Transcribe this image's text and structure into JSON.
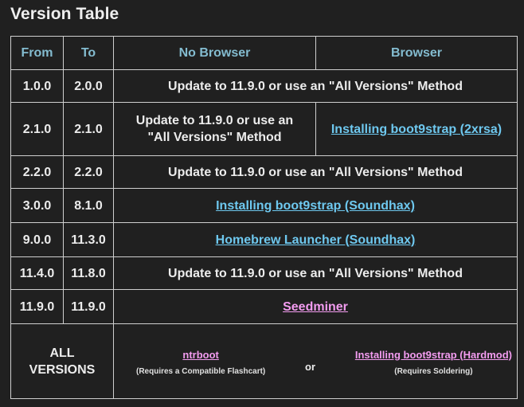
{
  "title": "Version Table",
  "headers": {
    "from": "From",
    "to": "To",
    "no_browser": "No Browser",
    "browser": "Browser"
  },
  "rows": [
    {
      "from": "1.0.0",
      "to": "2.0.0",
      "text": "Update to 11.9.0 or use an \"All Versions\" Method"
    },
    {
      "from": "2.1.0",
      "to": "2.1.0",
      "no_browser": "Update to 11.9.0 or use an \"All Versions\" Method",
      "browser_link": "Installing boot9strap (2xrsa)"
    },
    {
      "from": "2.2.0",
      "to": "2.2.0",
      "text": "Update to 11.9.0 or use an \"All Versions\" Method"
    },
    {
      "from": "3.0.0",
      "to": "8.1.0",
      "link": "Installing boot9strap (Soundhax)"
    },
    {
      "from": "9.0.0",
      "to": "11.3.0",
      "link": "Homebrew Launcher (Soundhax)"
    },
    {
      "from": "11.4.0",
      "to": "11.8.0",
      "text": "Update to 11.9.0 or use an \"All Versions\" Method"
    },
    {
      "from": "11.9.0",
      "to": "11.9.0",
      "link": "Seedminer"
    }
  ],
  "all_versions": {
    "label": "ALL VERSIONS",
    "ntrboot_link": "ntrboot",
    "ntrboot_note": "(Requires a Compatible Flashcart)",
    "or": "or",
    "hardmod_link": "Installing boot9strap (Hardmod)",
    "hardmod_note": "(Requires Soldering)"
  },
  "colors": {
    "background": "#202020",
    "header_text": "#84bcd0",
    "link_blue": "#6ec8ef",
    "link_pink": "#f39cf0",
    "border": "#cfcfcf"
  }
}
